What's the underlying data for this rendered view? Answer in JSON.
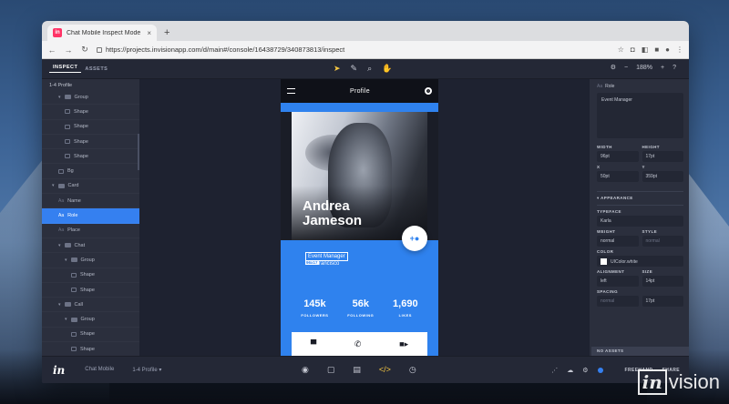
{
  "browser": {
    "tab_title": "Chat Mobile Inspect Mode - In",
    "tab_close": "×",
    "new_tab": "+",
    "url": "https://projects.invisionapp.com/d/main#/console/16438729/340873813/inspect"
  },
  "app": {
    "tabs": [
      "INSPECT",
      "ASSETS"
    ],
    "zoom": "188%",
    "zoom_minus": "−",
    "zoom_plus": "+"
  },
  "layers": {
    "title": "1-4 Profile",
    "items": [
      {
        "label": "Group",
        "type": "group",
        "indent": 2
      },
      {
        "label": "Shape",
        "type": "shape",
        "indent": 3
      },
      {
        "label": "Shape",
        "type": "shape",
        "indent": 3
      },
      {
        "label": "Shape",
        "type": "shape",
        "indent": 3
      },
      {
        "label": "Shape",
        "type": "shape",
        "indent": 3
      },
      {
        "label": "Bg",
        "type": "shape",
        "indent": 2
      },
      {
        "label": "Card",
        "type": "group",
        "indent": 1
      },
      {
        "label": "Name",
        "type": "text",
        "indent": 2
      },
      {
        "label": "Role",
        "type": "text",
        "indent": 2,
        "active": true
      },
      {
        "label": "Place",
        "type": "text",
        "indent": 2
      },
      {
        "label": "Chat",
        "type": "group",
        "indent": 2
      },
      {
        "label": "Group",
        "type": "group",
        "indent": 3
      },
      {
        "label": "Shape",
        "type": "shape",
        "indent": 4
      },
      {
        "label": "Shape",
        "type": "shape",
        "indent": 4
      },
      {
        "label": "Call",
        "type": "group",
        "indent": 2
      },
      {
        "label": "Group",
        "type": "group",
        "indent": 3
      },
      {
        "label": "Shape",
        "type": "shape",
        "indent": 4
      },
      {
        "label": "Shape",
        "type": "shape",
        "indent": 4
      }
    ]
  },
  "phone": {
    "title": "Profile",
    "name_line1": "Andrea",
    "name_line2": "Jameson",
    "role": "Event Manager",
    "dims": "96x17",
    "place": "rancisco",
    "stats": [
      {
        "num": "145k",
        "label": "FOLLOWERS"
      },
      {
        "num": "56k",
        "label": "FOLLOWING"
      },
      {
        "num": "1,690",
        "label": "LIKES"
      }
    ]
  },
  "inspector": {
    "layer_type": "Aa",
    "layer_name": "Role",
    "text_content": "Event Manager",
    "width_label": "WIDTH",
    "width": "96pt",
    "height_label": "HEIGHT",
    "height": "17pt",
    "x_label": "X",
    "x": "50pt",
    "y_label": "Y",
    "y": "359pt",
    "appearance": "APPEARANCE",
    "typeface_label": "TYPEFACE",
    "typeface": "Karla",
    "weight_label": "WEIGHT",
    "weight": "normal",
    "style_label": "STYLE",
    "style": "normal",
    "color_label": "COLOR",
    "color": "UIColor.white",
    "alignment_label": "ALIGNMENT",
    "alignment": "left",
    "size_label": "SIZE",
    "size": "14pt",
    "spacing_label": "SPACING",
    "spacing": "normal",
    "line_height": "17pt",
    "no_assets": "NO ASSETS"
  },
  "bottom": {
    "logo": "in",
    "project": "Chat Mobile",
    "screen": "1-4 Profile",
    "freehand": "FREEHAND",
    "share": "SHARE"
  },
  "watermark": {
    "in": "in",
    "vision": "vision"
  },
  "colors": {
    "accent": "#3580f0",
    "tool_active": "#f7c842",
    "card_blue": "#2f82ee"
  }
}
